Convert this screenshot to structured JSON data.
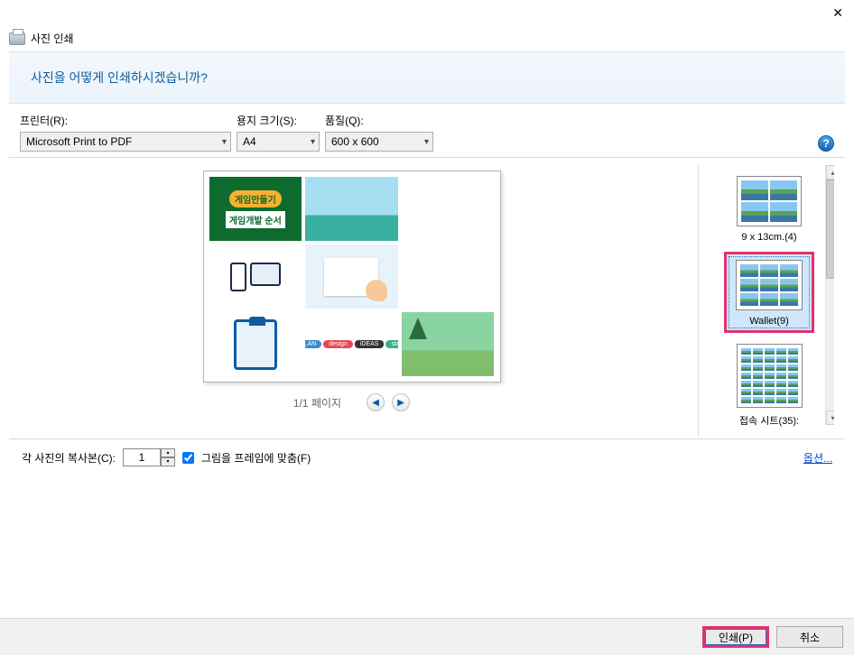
{
  "titlebar": {
    "close": "✕"
  },
  "window_title": "사진 인쇄",
  "banner_title": "사진을 어떻게 인쇄하시겠습니까?",
  "config": {
    "printer_label": "프린터(R):",
    "printer_value": "Microsoft Print to PDF",
    "paper_label": "용지 크기(S):",
    "paper_value": "A4",
    "quality_label": "품질(Q):",
    "quality_value": "600 x 600"
  },
  "preview": {
    "thumb1_badge": "게임만들기",
    "thumb1_sub": "게임개발 순서",
    "page_indicator": "1/1 페이지"
  },
  "layouts": {
    "opt1": "9 x 13cm.(4)",
    "opt2": "Wallet(9)",
    "opt3": "접속 시트(35):"
  },
  "lower": {
    "copies_label": "각 사진의 복사본(C):",
    "copies_value": "1",
    "fit_label": "그림을 프레임에 맞춤(F)",
    "options_link": "옵션..."
  },
  "footer": {
    "print": "인쇄(P)",
    "cancel": "취소"
  }
}
